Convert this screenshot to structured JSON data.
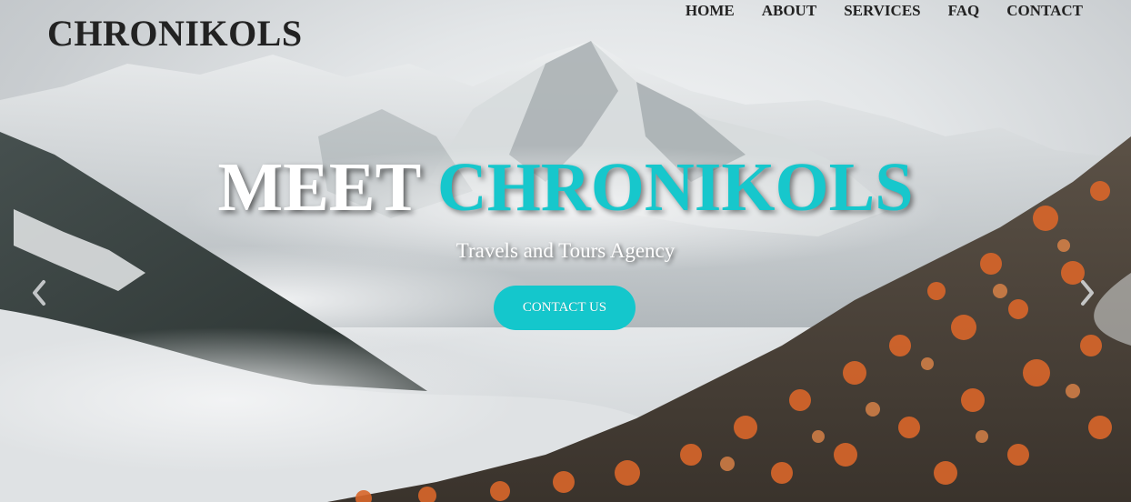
{
  "brand": {
    "name": "CHRONIKOLS"
  },
  "nav": {
    "items": [
      {
        "label": "HOME"
      },
      {
        "label": "ABOUT"
      },
      {
        "label": "SERVICES"
      },
      {
        "label": "FAQ"
      },
      {
        "label": "CONTACT"
      }
    ]
  },
  "hero": {
    "headline_part1": "MEET",
    "headline_part2": "CHRONIKOLS",
    "subtitle": "Travels and Tours Agency",
    "cta_label": "CONTACT US",
    "prev_icon": "chevron-left-icon",
    "next_icon": "chevron-right-icon"
  },
  "colors": {
    "accent": "#17c7cc",
    "text_dark": "#222222",
    "autumn": "#d9662a"
  }
}
